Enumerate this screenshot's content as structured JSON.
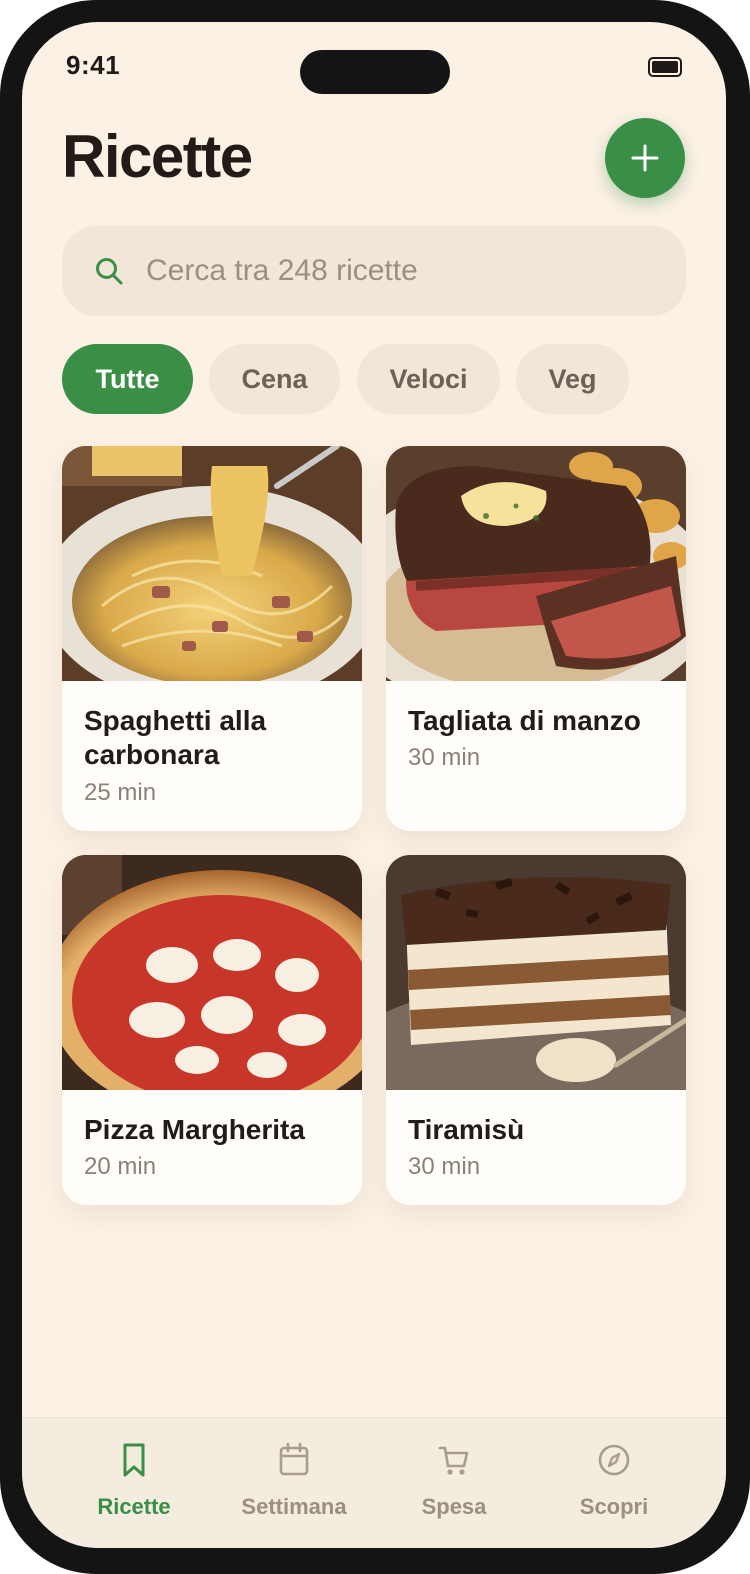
{
  "status_bar": {
    "time": "9:41"
  },
  "header": {
    "title": "Ricette",
    "add_label": "+"
  },
  "search": {
    "placeholder": "Cerca tra 248 ricette"
  },
  "filters": [
    {
      "label": "Tutte",
      "active": true
    },
    {
      "label": "Cena",
      "active": false
    },
    {
      "label": "Veloci",
      "active": false
    },
    {
      "label": "Veg",
      "active": false
    }
  ],
  "recipes": [
    {
      "title": "Spaghetti alla carbonara",
      "time": "25 min",
      "image": "carbonara-photo"
    },
    {
      "title": "Tagliata di manzo",
      "time": "30 min",
      "image": "steak-photo"
    },
    {
      "title": "Pizza Margherita",
      "time": "20 min",
      "image": "pizza-photo"
    },
    {
      "title": "Tiramisù",
      "time": "30 min",
      "image": "tiramisu-photo"
    }
  ],
  "tabs": [
    {
      "label": "Ricette",
      "icon": "bookmark-icon",
      "active": true
    },
    {
      "label": "Settimana",
      "icon": "calendar-icon",
      "active": false
    },
    {
      "label": "Spesa",
      "icon": "cart-icon",
      "active": false
    },
    {
      "label": "Scopri",
      "icon": "compass-icon",
      "active": false
    }
  ],
  "colors": {
    "accent": "#3a8f47",
    "background": "#fcf1e5",
    "chip": "#f1e6d8",
    "text": "#221c18",
    "muted": "#9b8f82"
  }
}
